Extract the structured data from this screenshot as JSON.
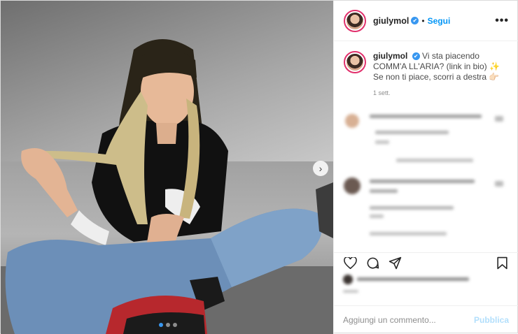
{
  "post": {
    "username": "giulymol",
    "verified_glyph": "✔",
    "separator": "•",
    "follow_label": "Segui",
    "more_label": "•••",
    "caption_user": "giulymol",
    "caption_line1": "Vi sta piacendo COMM'A LL'ARIA? (link in bio) ✨",
    "caption_line2": "Se non ti piace, scorri a destra 👉🏻",
    "time": "1 sett.",
    "next_arrow": "›"
  },
  "icons": {
    "like": "heart-icon",
    "comment": "comment-icon",
    "share": "paper-plane-icon",
    "save": "bookmark-icon",
    "verified": "verified-badge-icon"
  },
  "composer": {
    "placeholder": "Aggiungi un commento...",
    "publish_label": "Pubblica"
  },
  "carousel": {
    "dots": 3,
    "active_index": 0
  },
  "colors": {
    "accent": "#0095f6",
    "publish_disabled": "#b2dffc"
  }
}
